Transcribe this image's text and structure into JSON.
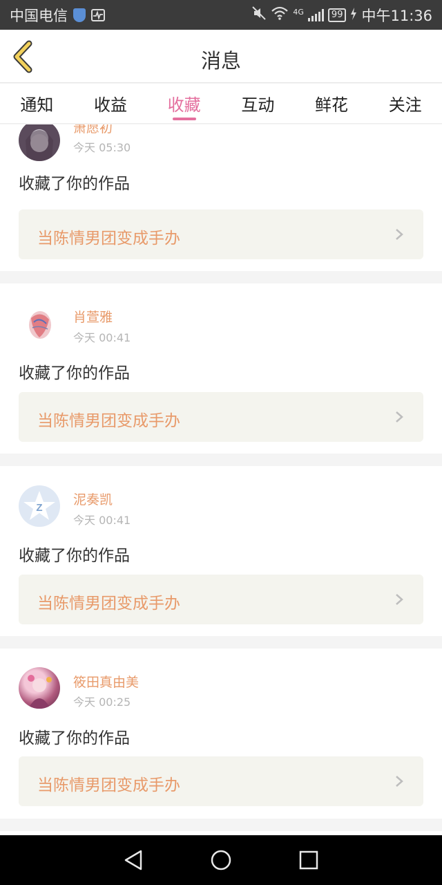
{
  "status_bar": {
    "carrier": "中国电信",
    "network": "4G",
    "battery": "99",
    "time": "中午11:36"
  },
  "header": {
    "title": "消息"
  },
  "tabs": [
    {
      "label": "通知",
      "active": false
    },
    {
      "label": "收益",
      "active": false
    },
    {
      "label": "收藏",
      "active": true
    },
    {
      "label": "互动",
      "active": false
    },
    {
      "label": "鲜花",
      "active": false
    },
    {
      "label": "关注",
      "active": false
    }
  ],
  "messages": [
    {
      "user": "萧愿初",
      "time": "今天 05:30",
      "action": "收藏了你的作品",
      "work_title": "当陈情男团变成手办",
      "avatar": "avatar-dark-hair"
    },
    {
      "user": "肖萱雅",
      "time": "今天 00:41",
      "action": "收藏了你的作品",
      "work_title": "当陈情男团变成手办",
      "avatar": "avatar-red-drawing"
    },
    {
      "user": "泥奏凯",
      "time": "今天 00:41",
      "action": "收藏了你的作品",
      "work_title": "当陈情男团变成手办",
      "avatar": "avatar-blue-star"
    },
    {
      "user": "筱田真由美",
      "time": "今天 00:25",
      "action": "收藏了你的作品",
      "work_title": "当陈情男团变成手办",
      "avatar": "avatar-pink-anime"
    }
  ],
  "colors": {
    "accent": "#e46f9e",
    "username": "#e89a6a",
    "work_bg": "#f4f4ee"
  },
  "icons": {
    "back": "chevron-left-icon",
    "row": "chevron-right-icon",
    "nav_back": "triangle-back-icon",
    "nav_home": "circle-home-icon",
    "nav_recent": "square-recent-icon"
  }
}
